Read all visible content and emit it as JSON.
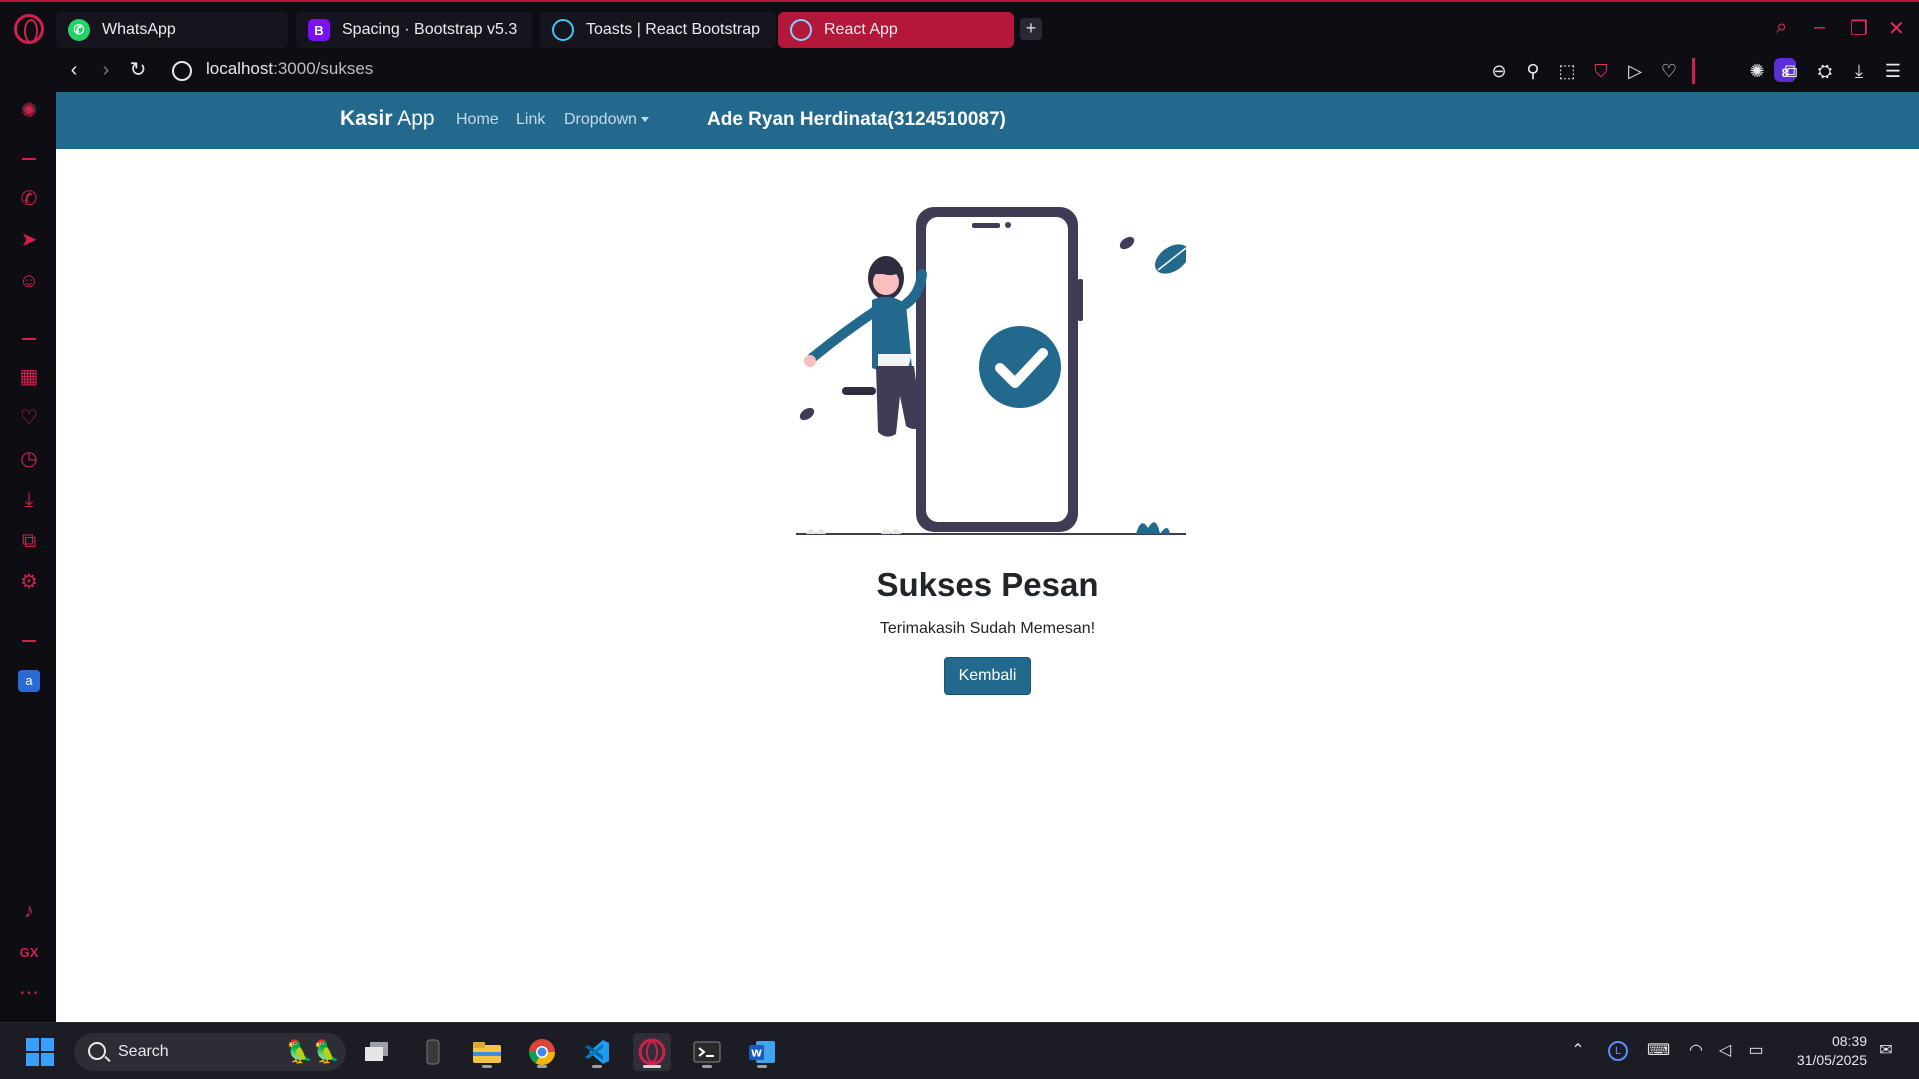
{
  "browser": {
    "tabs": [
      {
        "title": "WhatsApp",
        "favicon": "whatsapp-icon"
      },
      {
        "title": "Spacing · Bootstrap v5.3",
        "favicon": "bootstrap-icon"
      },
      {
        "title": "Toasts | React Bootstrap",
        "favicon": "react-bootstrap-icon"
      },
      {
        "title": "React App",
        "favicon": "react-icon",
        "active": true
      }
    ],
    "url_host": "localhost",
    "url_path": ":3000/sukses",
    "extension_badge": "8",
    "accent_color": "#d0214d"
  },
  "app": {
    "brand_bold": "Kasir",
    "brand_rest": " App",
    "nav": {
      "home": "Home",
      "link": "Link",
      "dropdown": "Dropdown"
    },
    "user": "Ade Ryan Herdinata(3124510087)",
    "navbar_color": "#22698d"
  },
  "success": {
    "title": "Sukses Pesan",
    "subtitle": "Terimakasih Sudah Memesan!",
    "button_label": "Kembali"
  },
  "taskbar": {
    "search_placeholder": "Search",
    "time": "08:39",
    "date": "31/05/2025"
  }
}
